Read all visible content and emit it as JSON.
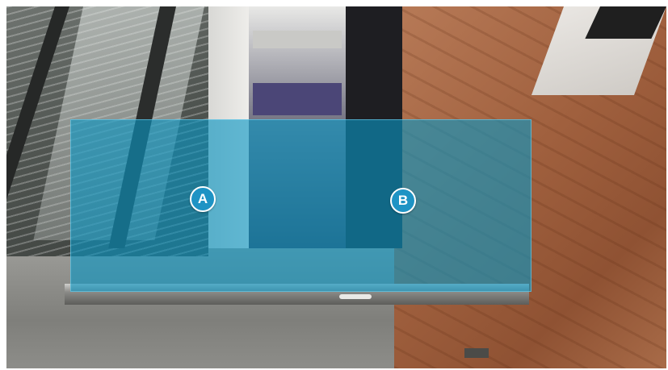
{
  "markers": {
    "a": {
      "label": "A"
    },
    "b": {
      "label": "B"
    }
  },
  "colors": {
    "overlay": "#0a96c3",
    "marker_fill": "#1e93c4",
    "marker_border": "#ffffff"
  }
}
